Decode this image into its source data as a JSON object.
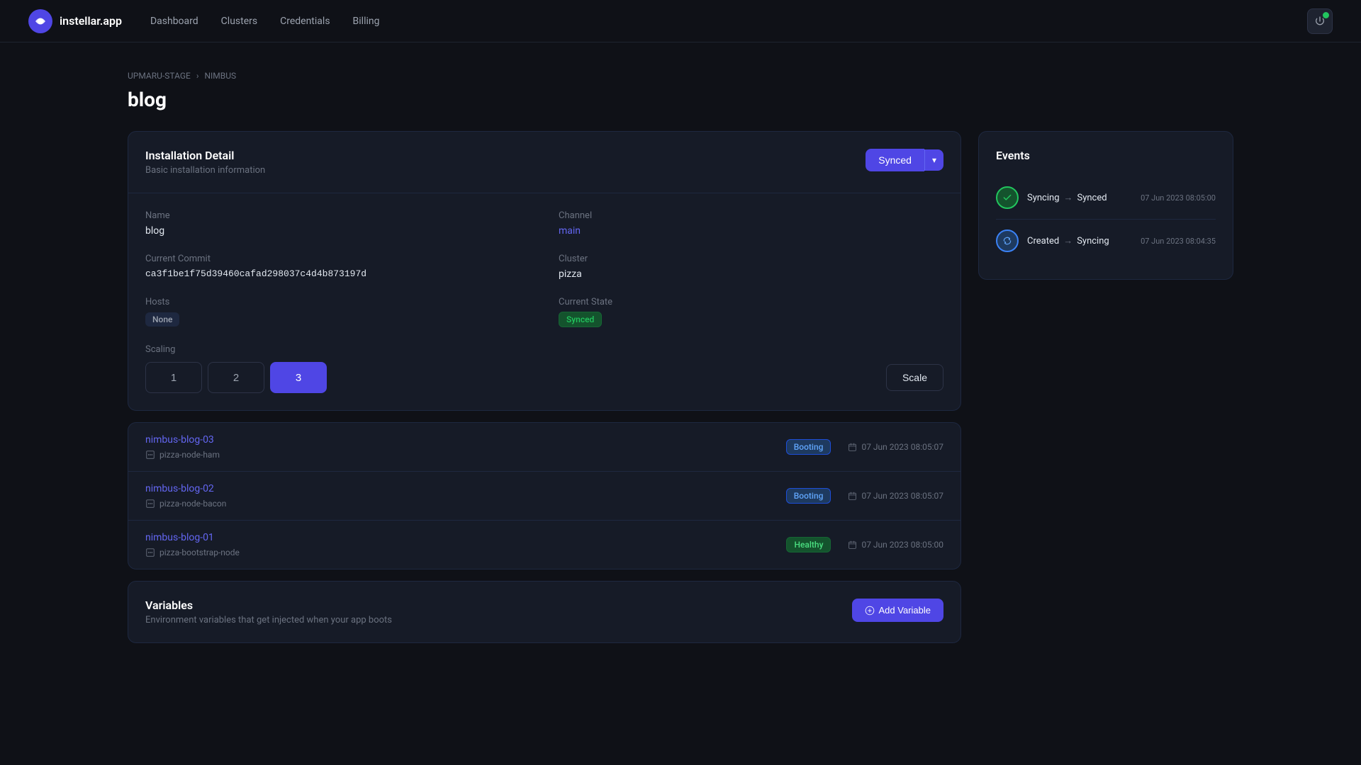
{
  "app": {
    "logo_text": "instellar.app",
    "nav_links": [
      "Dashboard",
      "Clusters",
      "Credentials",
      "Billing"
    ]
  },
  "breadcrumb": {
    "parent": "UPMARU-STAGE",
    "child": "NIMBUS"
  },
  "page_title": "blog",
  "installation_detail": {
    "title": "Installation Detail",
    "subtitle": "Basic installation information",
    "status_button": "Synced",
    "name_label": "Name",
    "name_value": "blog",
    "channel_label": "Channel",
    "channel_value": "main",
    "commit_label": "Current Commit",
    "commit_value": "ca3f1be1f75d39460cafad298037c4d4b873197d",
    "cluster_label": "Cluster",
    "cluster_value": "pizza",
    "hosts_label": "Hosts",
    "hosts_value": "None",
    "state_label": "Current State",
    "state_value": "Synced",
    "scaling_label": "Scaling",
    "scale_options": [
      1,
      2,
      3
    ],
    "scale_active": 3,
    "scale_button": "Scale"
  },
  "instances": [
    {
      "name": "nimbus-blog-03",
      "node": "pizza-node-ham",
      "status": "Booting",
      "date": "07 Jun 2023 08:05:07"
    },
    {
      "name": "nimbus-blog-02",
      "node": "pizza-node-bacon",
      "status": "Booting",
      "date": "07 Jun 2023 08:05:07"
    },
    {
      "name": "nimbus-blog-01",
      "node": "pizza-bootstrap-node",
      "status": "Healthy",
      "date": "07 Jun 2023 08:05:00"
    }
  ],
  "variables": {
    "title": "Variables",
    "subtitle": "Environment variables that get injected when your app boots",
    "add_button": "Add Variable"
  },
  "events": {
    "title": "Events",
    "items": [
      {
        "from_state": "Syncing",
        "to_state": "Synced",
        "type": "success",
        "time": "07 Jun 2023 08:05:00"
      },
      {
        "from_state": "Created",
        "to_state": "Syncing",
        "type": "progress",
        "time": "07 Jun 2023 08:04:35"
      }
    ]
  }
}
